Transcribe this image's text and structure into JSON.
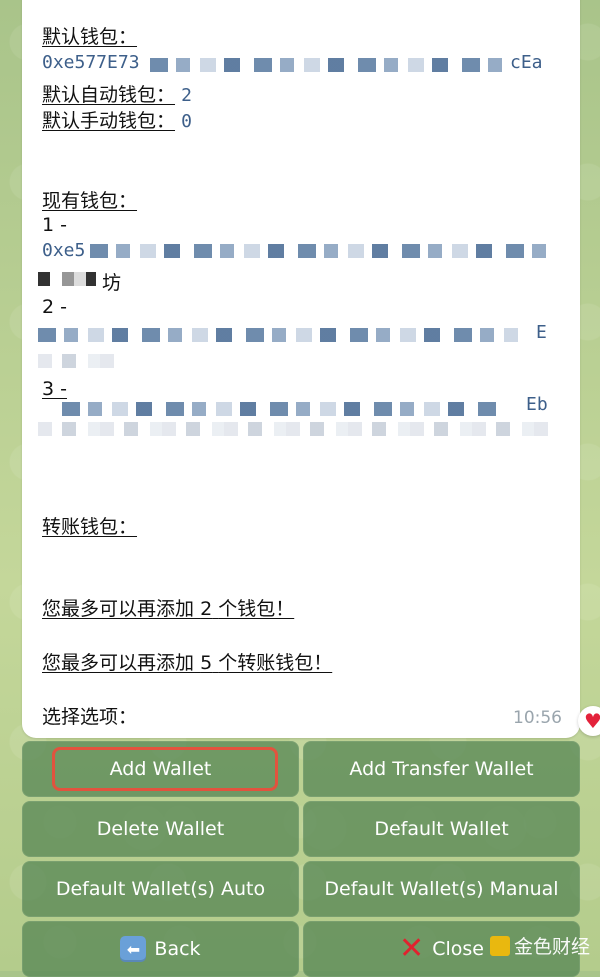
{
  "message": {
    "default_wallet_label": "默认钱包：",
    "default_wallet_addr_start": "0xe577E73",
    "default_wallet_addr_end": "cEa",
    "default_auto_label": "默认自动钱包：",
    "default_auto_value": "2",
    "default_manual_label": "默认手动钱包：",
    "default_manual_value": "0",
    "existing_label": "现有钱包：",
    "wallets": [
      {
        "index": "1 -",
        "addr_start": "0xe5",
        "note_tail": "坊"
      },
      {
        "index": "2 -",
        "addr_end": "E"
      },
      {
        "index": "3 -",
        "addr_end": "Eb"
      }
    ],
    "transfer_label": "转账钱包：",
    "limit_wallet_pre": "您最多可以再添加",
    "limit_wallet_num": "2",
    "limit_wallet_post": "个钱包！",
    "limit_transfer_pre": "您最多可以再添加",
    "limit_transfer_num": "5",
    "limit_transfer_post": "个转账钱包！",
    "choose_label": "选择选项：",
    "time": "10:56"
  },
  "keyboard": {
    "rows": [
      [
        "Add Wallet",
        "Add Transfer Wallet"
      ],
      [
        "Delete Wallet",
        "Default Wallet"
      ],
      [
        "Default Wallet(s) Auto",
        "Default Wallet(s) Manual"
      ],
      [
        "Back",
        "Close"
      ]
    ]
  },
  "reaction": "heart",
  "highlight": {
    "color": "#e2533e",
    "target": "Add Wallet"
  },
  "watermark": {
    "text": "金色财经"
  },
  "colors": {
    "button_bg": "#528252",
    "address": "#3d5f8a",
    "time": "#9aa5ad"
  }
}
